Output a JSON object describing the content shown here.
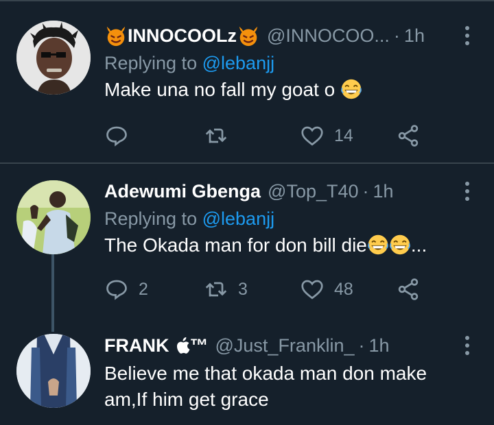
{
  "tweets": [
    {
      "name": "INNOCOOLz",
      "handle": "@INNOCOO...",
      "time": "1h",
      "replying_prefix": "Replying to",
      "replying_to": "@lebanjj",
      "text": "Make una no fall my goat o",
      "replies": "",
      "retweets": "",
      "likes": "14"
    },
    {
      "name": "Adewumi Gbenga",
      "handle": "@Top_T40",
      "time": "1h",
      "replying_prefix": "Replying to",
      "replying_to": "@lebanjj",
      "text": "The Okada man for don bill die",
      "text_suffix": "...",
      "replies": "2",
      "retweets": "3",
      "likes": "48"
    },
    {
      "name": "FRANK",
      "name_suffix": "™",
      "handle": "@Just_Franklin_",
      "time": "1h",
      "text_line1": "Believe me that okada man don make",
      "text_line2": "am,If him get grace"
    }
  ],
  "dot": "·",
  "colors": {
    "background": "#15202b",
    "secondary": "#8899a6",
    "link": "#1d9bf0",
    "divider": "#38444d"
  },
  "icons": [
    "reply-icon",
    "retweet-icon",
    "like-icon",
    "share-icon",
    "more-icon",
    "devil-emoji",
    "laughing-emoji",
    "apple-logo-icon"
  ]
}
